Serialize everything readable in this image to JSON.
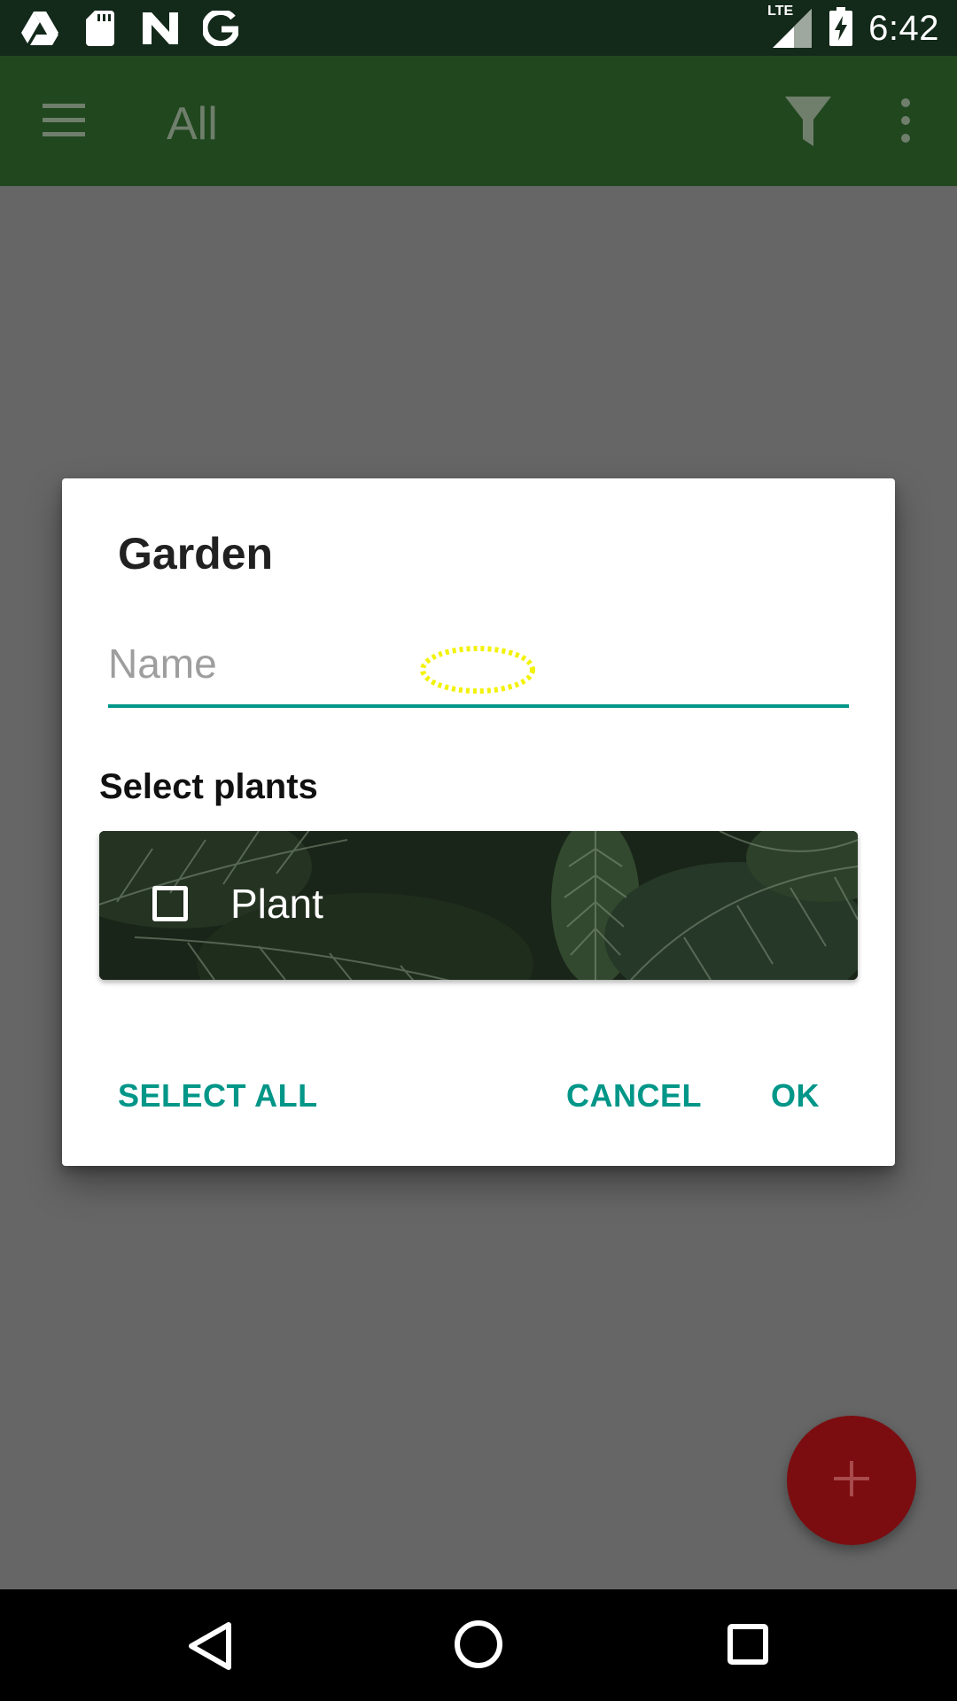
{
  "status_bar": {
    "time": "6:42",
    "network_label": "LTE",
    "left_icons": [
      "drive-icon",
      "sd-card-icon",
      "n-app-icon",
      "google-icon"
    ],
    "right_icons": [
      "signal-icon",
      "battery-charging-icon"
    ]
  },
  "app_bar": {
    "title": "All",
    "icons": [
      "menu-icon",
      "filter-icon",
      "overflow-menu-icon"
    ],
    "color": "#21471f"
  },
  "dialog": {
    "title": "Garden",
    "name_input": {
      "placeholder": "Name",
      "value": ""
    },
    "section_label": "Select plants",
    "plants": [
      {
        "label": "Plant",
        "checked": false
      }
    ],
    "buttons": {
      "select_all": "SELECT ALL",
      "cancel": "CANCEL",
      "ok": "OK"
    },
    "accent_color": "#009688"
  },
  "fab": {
    "icon": "plus-icon",
    "color": "#7b0d10"
  },
  "nav_bar": {
    "icons": [
      "back-icon",
      "home-icon",
      "recents-icon"
    ]
  }
}
